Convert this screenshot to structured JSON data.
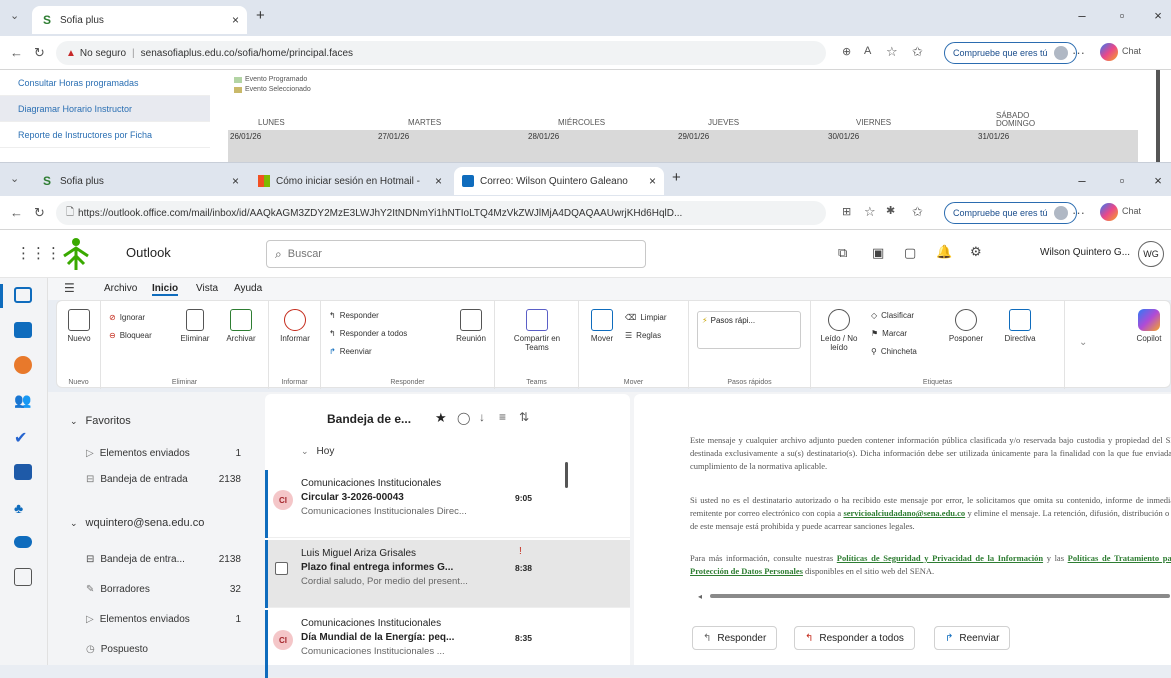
{
  "back_window": {
    "tab_title": "Sofia plus",
    "close": "×",
    "newtab": "+",
    "not_secure": "No seguro",
    "url": "senasofiaplus.edu.co/sofia/home/principal.faces",
    "compare_pill": "Compruebe que eres tú",
    "min": "–",
    "max": "▫",
    "closewin": "×",
    "sidebar": [
      {
        "label": "Consultar Horas programadas",
        "selected": false
      },
      {
        "label": "Diagramar Horario Instructor",
        "selected": true
      },
      {
        "label": "Reporte de Instructores por Ficha",
        "selected": false
      }
    ],
    "legend_1": "Evento Seleccionado",
    "legend_0": "Evento Programado",
    "days": [
      "LUNES",
      "MARTES",
      "MIÉRCOLES",
      "JUEVES",
      "VIERNES",
      "SÁBADO DOMINGO"
    ],
    "dates": [
      "26/01/26",
      "27/01/26",
      "28/01/26",
      "29/01/26",
      "30/01/26",
      "31/01/26"
    ]
  },
  "front_window": {
    "tabs": [
      {
        "label": "Sofia plus",
        "active": false
      },
      {
        "label": "Cómo iniciar sesión en Hotmail - ",
        "active": false
      },
      {
        "label": "Correo: Wilson Quintero Galeano",
        "active": true
      }
    ],
    "url": "https://outlook.office.com/mail/inbox/id/AAQkAGM3ZDY2MzE3LWJhY2ItNDNmYi1hNTIoLTQ4MzVkZWJlMjA4DQAQAAUwrjKHd6HqlD...",
    "compare_pill": "Compruebe que eres tú"
  },
  "outlook": {
    "app_name": "Outlook",
    "search_placeholder": "Buscar",
    "user_name": "Wilson Quintero G...",
    "user_initials": "WG",
    "menu_tabs": [
      "Archivo",
      "Inicio",
      "Vista",
      "Ayuda"
    ],
    "ribbon": {
      "nuevo": "Nuevo",
      "ignorar": "Ignorar",
      "bloquear": "Bloquear",
      "eliminar": "Eliminar",
      "archivar": "Archivar",
      "informar": "Informar",
      "responder": "Responder",
      "responder_todos": "Responder a todos",
      "reenviar": "Reenviar",
      "reunion": "Reunión",
      "compartir": "Compartir en Teams",
      "mover": "Mover",
      "limpiar": "Limpiar",
      "reglas": "Reglas",
      "pasos": "Pasos rápi...",
      "leido": "Leído / No leído",
      "clasificar": "Clasificar",
      "marcar": "Marcar",
      "chincheta": "Chincheta",
      "posponer": "Posponer",
      "directiva": "Directiva",
      "copilot": "Copilot",
      "group_nuevo": "Nuevo",
      "group_eliminar": "Eliminar",
      "group_informar": "Informar",
      "group_responder": "Responder",
      "group_teams": "Teams",
      "group_mover": "Mover",
      "group_pasos": "Pasos rápidos",
      "group_etiquetas": "Etiquetas"
    },
    "folders": {
      "favoritos": "Favoritos",
      "fav_items": [
        {
          "label": "Elementos enviados",
          "count": "1"
        },
        {
          "label": "Bandeja de entrada",
          "count": "2138"
        }
      ],
      "account": "wquintero@sena.edu.co",
      "acc_items": [
        {
          "label": "Bandeja de entra...",
          "count": "2138"
        },
        {
          "label": "Borradores",
          "count": "32"
        },
        {
          "label": "Elementos enviados",
          "count": "1"
        },
        {
          "label": "Pospuesto",
          "count": ""
        }
      ]
    },
    "list": {
      "title": "Bandeja de e...",
      "group": "Hoy",
      "messages": [
        {
          "initials": "CI",
          "sender": "Comunicaciones Institucionales",
          "subject": "Circular 3-2026-00043",
          "time": "9:05",
          "preview": "Comunicaciones Institucionales Direc..."
        },
        {
          "initials": "",
          "sender": "Luis Miguel Ariza Grisales",
          "subject": "Plazo final entrega informes G...",
          "time": "8:38",
          "preview": "Cordial saludo, Por medio del present..."
        },
        {
          "initials": "CI",
          "sender": "Comunicaciones Institucionales",
          "subject": "Día Mundial de la Energía: peq...",
          "time": "8:35",
          "preview": "Comunicaciones Institucionales ..."
        }
      ]
    },
    "reading": {
      "p1": "Este mensaje y cualquier archivo adjunto pueden contener información pública clasificada y/o reservada bajo custodia y propiedad del SENA, destinada exclusivamente a su(s) destinatario(s). Dicha información debe ser utilizada únicamente para la finalidad con la que fue enviada y en cumplimiento de la normativa aplicable.",
      "p2a": "Si usted no es el destinatario autorizado o ha recibido este mensaje por error, le solicitamos que omita su contenido, informe de inmediato al remitente por correo electrónico con copia a ",
      "p2link": "servicioalciudadano@sena.edu.co",
      "p2b": " y elimine el mensaje. La retención, difusión, distribución o copia de este mensaje está prohibida y puede acarrear sanciones legales.",
      "p3a": "Para más información, consulte nuestras ",
      "p3link1": "Políticas de Seguridad y Privacidad de la Información",
      "p3b": " y las ",
      "p3link2": "Políticas de Tratamiento para la Protección de Datos Personales",
      "p3c": " disponibles en el sitio web del SENA.",
      "btn_reply": "Responder",
      "btn_reply_all": "Responder a todos",
      "btn_forward": "Reenviar"
    }
  }
}
